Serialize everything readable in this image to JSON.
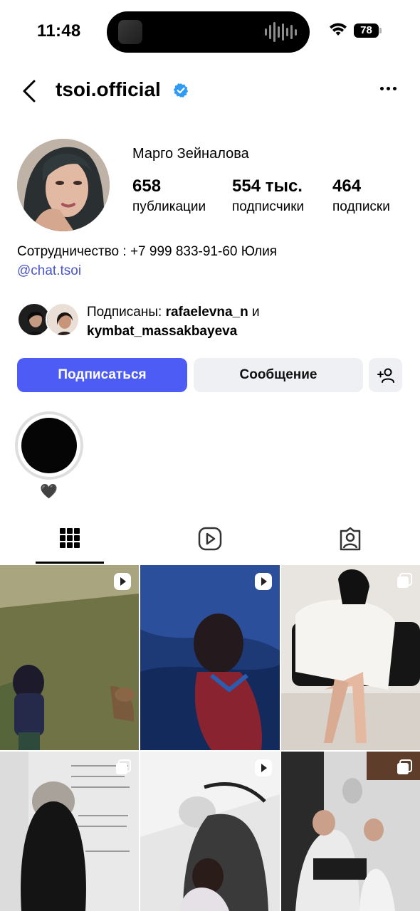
{
  "status_bar": {
    "time": "11:48",
    "battery": "78"
  },
  "header": {
    "username": "tsoi.official"
  },
  "profile": {
    "full_name": "Марго Зейналова",
    "stats": [
      {
        "value": "658",
        "label": "публикации"
      },
      {
        "value": "554 тыс.",
        "label": "подписчики"
      },
      {
        "value": "464",
        "label": "подписки"
      }
    ],
    "bio": "Сотрудничество : +7 999 833-91-60 Юлия",
    "bio_link": "@chat.tsoi",
    "followed_by": {
      "prefix": "Подписаны: ",
      "user1": "rafaelevna_n",
      "joiner": " и",
      "user2": "kymbat_massakbayeva"
    }
  },
  "actions": {
    "follow": "Подписаться",
    "message": "Сообщение"
  },
  "highlights": [
    {
      "label": "🖤"
    }
  ],
  "tabs": [
    "grid",
    "reels",
    "tagged"
  ],
  "grid_posts": [
    {
      "type": "reel",
      "colors": [
        "#8b8a63",
        "#4e5a36"
      ]
    },
    {
      "type": "reel",
      "colors": [
        "#203e7a",
        "#0c1c3d"
      ]
    },
    {
      "type": "carousel",
      "colors": [
        "#e9e6e2",
        "#cfc8c0"
      ]
    },
    {
      "type": "carousel",
      "colors": [
        "#d8d8d8",
        "#2b2b2b"
      ]
    },
    {
      "type": "reel",
      "colors": [
        "#e4e4e4",
        "#6d6d6d"
      ]
    },
    {
      "type": "carousel",
      "colors": [
        "#3a3a3a",
        "#cfcfcf"
      ]
    }
  ]
}
